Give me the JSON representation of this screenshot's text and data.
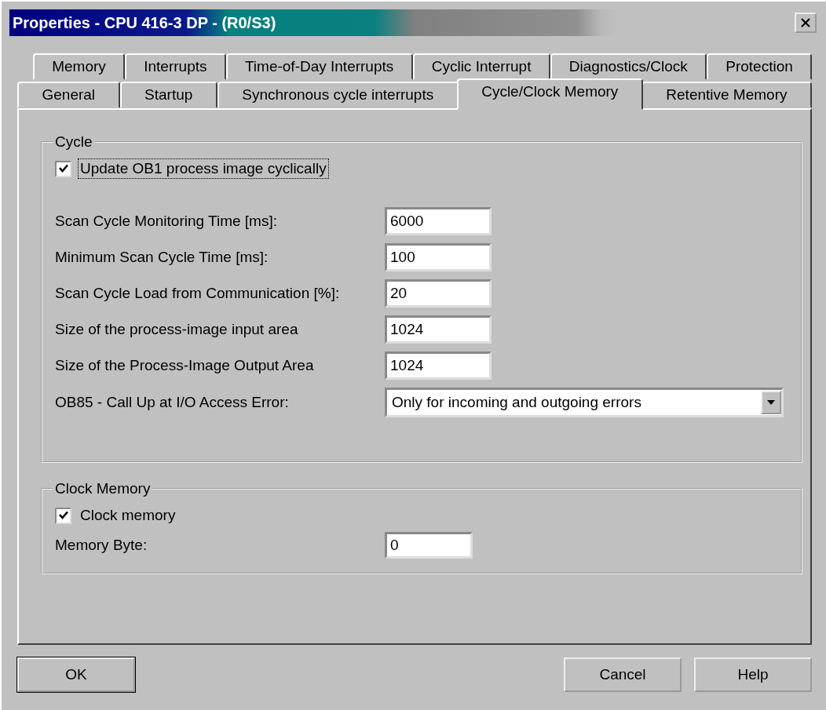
{
  "window": {
    "title": "Properties - CPU 416-3 DP - (R0/S3)"
  },
  "tab_rows": [
    [
      {
        "label": "Memory",
        "selected": false
      },
      {
        "label": "Interrupts",
        "selected": false
      },
      {
        "label": "Time-of-Day Interrupts",
        "selected": false
      },
      {
        "label": "Cyclic Interrupt",
        "selected": false
      },
      {
        "label": "Diagnostics/Clock",
        "selected": false
      },
      {
        "label": "Protection",
        "selected": false
      }
    ],
    [
      {
        "label": "General",
        "selected": false
      },
      {
        "label": "Startup",
        "selected": false
      },
      {
        "label": "Synchronous cycle interrupts",
        "selected": false
      },
      {
        "label": "Cycle/Clock Memory",
        "selected": true
      },
      {
        "label": "Retentive Memory",
        "selected": false
      }
    ]
  ],
  "groups": [
    {
      "title": "Cycle",
      "checkbox": {
        "label": "Update OB1 process image cyclically",
        "checked": true,
        "focused": true
      },
      "fields": [
        {
          "kind": "text",
          "label": "Scan Cycle Monitoring Time [ms]:",
          "value": "6000"
        },
        {
          "kind": "text",
          "label": "Minimum Scan Cycle Time [ms]:",
          "value": "100"
        },
        {
          "kind": "text",
          "label": "Scan Cycle Load from Communication [%]:",
          "value": "20"
        },
        {
          "kind": "text",
          "label": "Size of the process-image input area",
          "value": "1024"
        },
        {
          "kind": "text",
          "label": "Size of the Process-Image Output Area",
          "value": "1024"
        },
        {
          "kind": "dropdown",
          "label": "OB85 - Call Up at I/O Access Error:",
          "value": "Only for incoming and outgoing errors"
        }
      ]
    },
    {
      "title": "Clock Memory",
      "checkbox": {
        "label": "Clock memory",
        "checked": true,
        "focused": false
      },
      "fields": [
        {
          "kind": "text",
          "label": "Memory Byte:",
          "value": "0"
        }
      ]
    }
  ],
  "buttons": [
    {
      "label": "OK",
      "default": true
    },
    {
      "label": "Cancel",
      "default": false
    },
    {
      "label": "Help",
      "default": false
    }
  ]
}
